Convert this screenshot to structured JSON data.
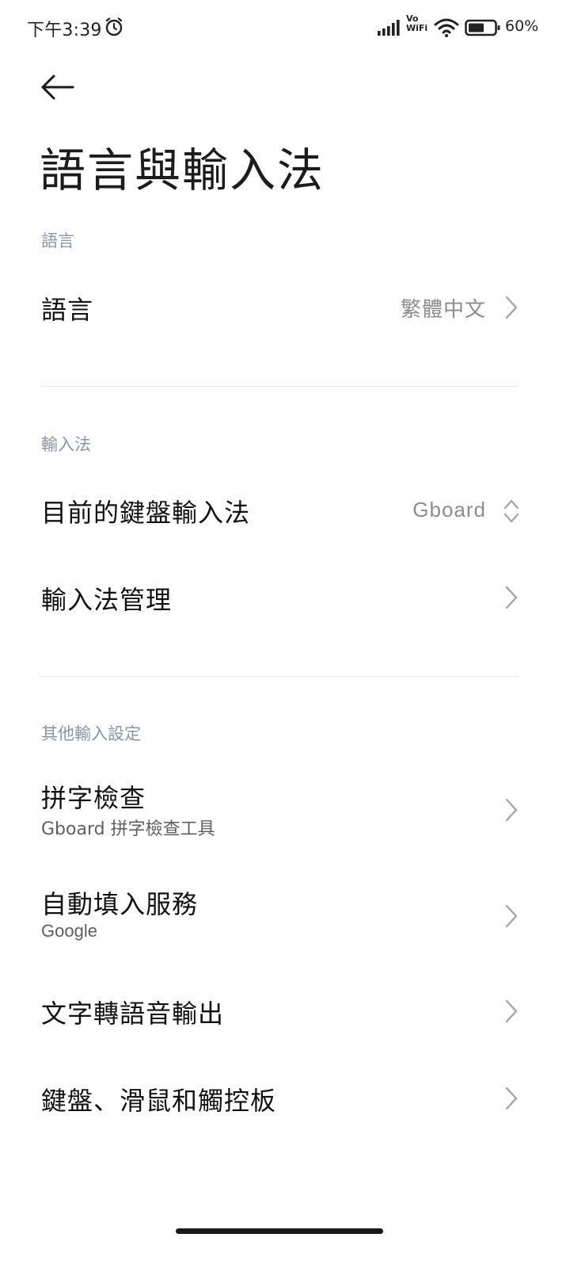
{
  "status_bar": {
    "time": "下午3:39",
    "vowifi_line1": "Vo",
    "vowifi_line2": "WiFi",
    "battery": "60%",
    "icons": [
      "alarm-icon",
      "signal-icon",
      "wifi-icon",
      "battery-icon"
    ]
  },
  "header": {
    "back_icon": "back-arrow-icon",
    "title": "語言與輸入法"
  },
  "sections": {
    "language": {
      "header": "語言",
      "items": [
        {
          "title": "語言",
          "value": "繁體中文",
          "icon": "chevron-right-icon"
        }
      ]
    },
    "input_method": {
      "header": "輸入法",
      "items": [
        {
          "title": "目前的鍵盤輸入法",
          "value": "Gboard",
          "icon": "up-down-chevron-icon"
        },
        {
          "title": "輸入法管理",
          "icon": "chevron-right-icon"
        }
      ]
    },
    "other": {
      "header": "其他輸入設定",
      "items": [
        {
          "title": "拼字檢查",
          "subtitle": "Gboard 拼字檢查工具",
          "icon": "chevron-right-icon"
        },
        {
          "title": "自動填入服務",
          "subtitle": "Google",
          "icon": "chevron-right-icon"
        },
        {
          "title": "文字轉語音輸出",
          "icon": "chevron-right-icon"
        },
        {
          "title": "鍵盤、滑鼠和觸控板",
          "icon": "chevron-right-icon"
        }
      ]
    }
  },
  "colors": {
    "section_header": "#8a93a6",
    "value_text": "#8c8c8c",
    "divider": "#e4e4e4"
  }
}
